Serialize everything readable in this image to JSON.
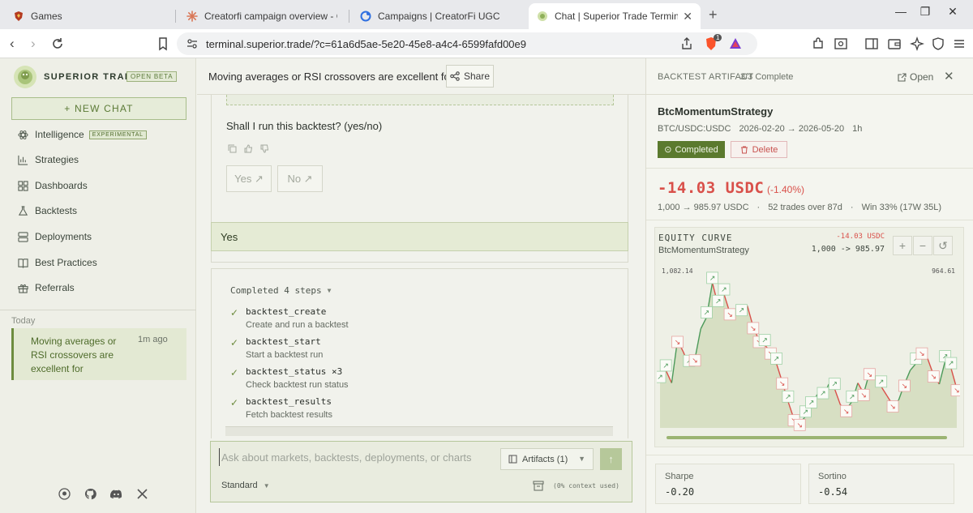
{
  "browser": {
    "tabs": [
      {
        "title": "Games",
        "icon": "shield-icon"
      },
      {
        "title": "Creatorfi campaign overview - Claude",
        "icon": "claude-icon"
      },
      {
        "title": "Campaigns | CreatorFi UGC",
        "icon": "creatorfi-icon"
      },
      {
        "title": "Chat | Superior Trade Terminal",
        "icon": "superior-icon",
        "close": "✕"
      }
    ],
    "url": "terminal.superior.trade/?c=61a6d5ae-5e20-45e8-a4c4-6599fafd00e9",
    "brave_badge": "1"
  },
  "sidebar": {
    "brand": "SUPERIOR TRADE",
    "beta_badge": "OPEN BETA",
    "new_chat": "+ NEW CHAT",
    "nav": [
      {
        "label": "Intelligence",
        "badge": "EXPERIMENTAL",
        "icon": "atom-icon"
      },
      {
        "label": "Strategies",
        "icon": "chart-icon"
      },
      {
        "label": "Dashboards",
        "icon": "grid-icon"
      },
      {
        "label": "Backtests",
        "icon": "flask-icon"
      },
      {
        "label": "Deployments",
        "icon": "server-icon"
      },
      {
        "label": "Best Practices",
        "icon": "book-icon"
      },
      {
        "label": "Referrals",
        "icon": "gift-icon"
      }
    ],
    "section_label": "Today",
    "chats": [
      {
        "title": "Moving averages or RSI crossovers are excellent for",
        "time": "1m ago"
      }
    ]
  },
  "chat": {
    "title": "Moving averages or RSI crossovers are excellent for",
    "share_label": "Share",
    "question": "Shall I run this backtest? (yes/no)",
    "yes_label": "Yes ↗",
    "no_label": "No ↗",
    "user_reply": "Yes",
    "steps_summary": "Completed 4 steps",
    "steps": [
      {
        "name": "backtest_create",
        "desc": "Create and run a backtest"
      },
      {
        "name": "backtest_start",
        "desc": "Start a backtest run"
      },
      {
        "name": "backtest_status ×3",
        "desc": "Check backtest run status"
      },
      {
        "name": "backtest_results",
        "desc": "Fetch backtest results"
      }
    ],
    "composer": {
      "placeholder": "Ask about markets, backtests, deployments, or charts",
      "artifacts_label": "Artifacts",
      "artifacts_count": "(1)",
      "mode": "Standard",
      "context": "(0% context used)"
    }
  },
  "panel": {
    "label": "BACKTEST ARTIFACT",
    "status": "3/3 Complete",
    "open_label": "Open",
    "strategy": "BtcMomentumStrategy",
    "pair": "BTC/USDC:USDC",
    "range": "2026-02-20 → 2026-05-20",
    "timeframe": "1h",
    "completed_label": "Completed",
    "delete_label": "Delete",
    "pnl": "-14.03 USDC",
    "pnl_pct": "(-1.40%)",
    "balance": "1,000 → 985.97 USDC",
    "dot": "·",
    "trades": "52 trades over 87d",
    "win": "Win 33% (17W 35L)",
    "equity": {
      "title": "EQUITY CURVE",
      "subtitle": "BtcMomentumStrategy",
      "delta": "-14.03 USDC",
      "range": "1,000 -> 985.97",
      "zoom_in": "+",
      "zoom_out": "−",
      "reset": "↺"
    },
    "metrics": [
      {
        "label": "Sharpe",
        "value": "-0.20"
      },
      {
        "label": "Sortino",
        "value": "-0.54"
      }
    ],
    "colors": {
      "accent": "#5b7a2e",
      "loss": "#d9504a",
      "profit": "#4c9a5a"
    }
  },
  "chart_data": {
    "type": "line",
    "title": "EQUITY CURVE",
    "subtitle": "BtcMomentumStrategy",
    "max_label": "1,082.14",
    "right_label": "964.61",
    "y_range": [
      952,
      1082.14
    ],
    "series": [
      {
        "name": "BtcMomentumStrategy",
        "values": [
          992,
          1002,
          991,
          1028,
          1018,
          1006,
          1012,
          1038,
          1048,
          1078,
          1058,
          1068,
          1052,
          1055,
          1050,
          1058,
          1040,
          1028,
          1024,
          1018,
          1008,
          992,
          975,
          960,
          956,
          962,
          970,
          981,
          978,
          990,
          986,
          972,
          968,
          975,
          991,
          982,
          1000,
          994,
          988,
          980,
          972,
          976,
          990,
          1002,
          1008,
          1018,
          1012,
          998,
          990,
          1010,
          1004,
          986
        ]
      }
    ],
    "trade_markers": [
      {
        "i": 0,
        "dir": "up"
      },
      {
        "i": 1,
        "dir": "up"
      },
      {
        "i": 3,
        "dir": "down"
      },
      {
        "i": 5,
        "dir": "up"
      },
      {
        "i": 6,
        "dir": "down"
      },
      {
        "i": 8,
        "dir": "up"
      },
      {
        "i": 9,
        "dir": "up"
      },
      {
        "i": 10,
        "dir": "up"
      },
      {
        "i": 11,
        "dir": "up"
      },
      {
        "i": 12,
        "dir": "down"
      },
      {
        "i": 14,
        "dir": "up"
      },
      {
        "i": 16,
        "dir": "down"
      },
      {
        "i": 17,
        "dir": "down"
      },
      {
        "i": 18,
        "dir": "up"
      },
      {
        "i": 19,
        "dir": "down"
      },
      {
        "i": 20,
        "dir": "up"
      },
      {
        "i": 21,
        "dir": "down"
      },
      {
        "i": 22,
        "dir": "up"
      },
      {
        "i": 23,
        "dir": "down"
      },
      {
        "i": 24,
        "dir": "down"
      },
      {
        "i": 25,
        "dir": "up"
      },
      {
        "i": 26,
        "dir": "up"
      },
      {
        "i": 28,
        "dir": "up"
      },
      {
        "i": 30,
        "dir": "up"
      },
      {
        "i": 32,
        "dir": "down"
      },
      {
        "i": 33,
        "dir": "up"
      },
      {
        "i": 35,
        "dir": "down"
      },
      {
        "i": 36,
        "dir": "down"
      },
      {
        "i": 38,
        "dir": "up"
      },
      {
        "i": 40,
        "dir": "down"
      },
      {
        "i": 42,
        "dir": "down"
      },
      {
        "i": 44,
        "dir": "up"
      },
      {
        "i": 45,
        "dir": "down"
      },
      {
        "i": 47,
        "dir": "down"
      },
      {
        "i": 49,
        "dir": "up"
      },
      {
        "i": 50,
        "dir": "up"
      },
      {
        "i": 51,
        "dir": "down"
      }
    ]
  }
}
